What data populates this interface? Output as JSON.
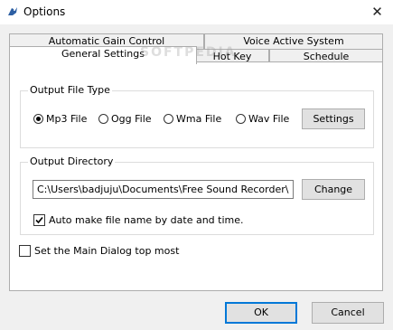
{
  "window": {
    "title": "Options",
    "close_glyph": "✕",
    "app_icon": "bird-icon"
  },
  "tabs": {
    "row_back": [
      "Automatic Gain Control",
      "Voice Active System"
    ],
    "row_front": [
      "General Settings",
      "Hot Key",
      "Schedule"
    ],
    "active": "General Settings"
  },
  "watermark": "SOFTPEDIA",
  "output_file_type": {
    "label": "Output File Type",
    "options": [
      "Mp3 File",
      "Ogg File",
      "Wma File",
      "Wav File"
    ],
    "selected": "Mp3 File",
    "settings_label": "Settings"
  },
  "output_directory": {
    "label": "Output Directory",
    "path": "C:\\Users\\badjuju\\Documents\\Free Sound Recorder\\",
    "change_label": "Change",
    "auto_name_label": "Auto make file name by date and time.",
    "auto_name_checked": true
  },
  "top_most": {
    "label": "Set the Main Dialog top most",
    "checked": false
  },
  "footer": {
    "ok_label": "OK",
    "cancel_label": "Cancel"
  }
}
